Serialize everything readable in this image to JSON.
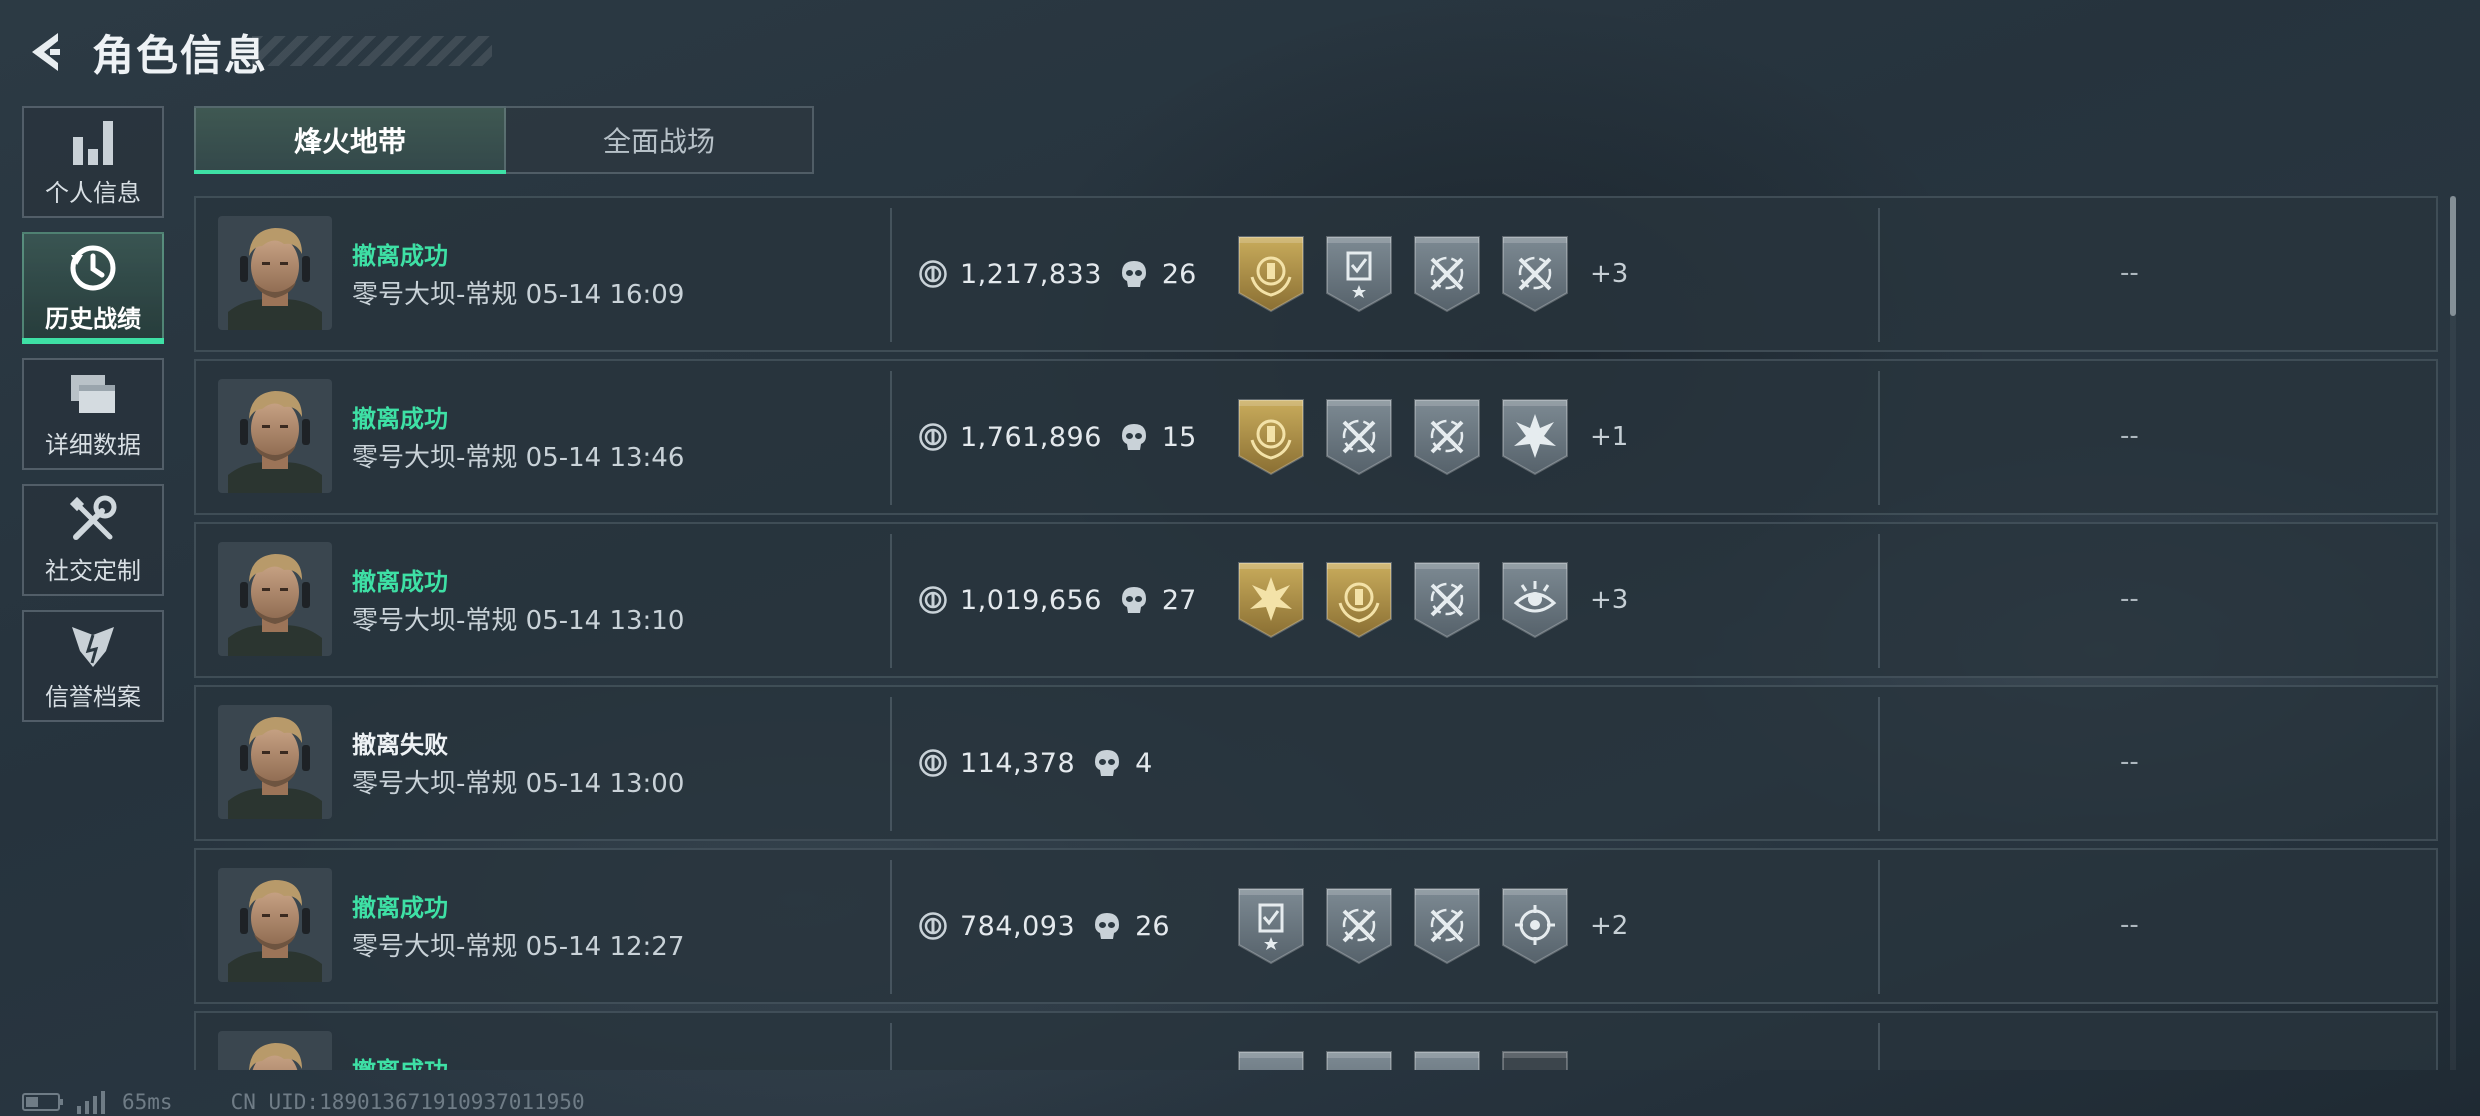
{
  "header": {
    "title": "角色信息"
  },
  "sidebar": {
    "items": [
      {
        "label": "个人信息",
        "icon": "bar-chart-icon",
        "active": false
      },
      {
        "label": "历史战绩",
        "icon": "history-clock-icon",
        "active": true
      },
      {
        "label": "详细数据",
        "icon": "folder-icon",
        "active": false
      },
      {
        "label": "社交定制",
        "icon": "wrench-screwdriver-icon",
        "active": false
      },
      {
        "label": "信誉档案",
        "icon": "reputation-icon",
        "active": false
      }
    ]
  },
  "tabs": [
    {
      "label": "烽火地带",
      "active": true
    },
    {
      "label": "全面战场",
      "active": false
    }
  ],
  "records": [
    {
      "status": "撤离成功",
      "result": "success",
      "map": "零号大坝-常规 05-14 16:09",
      "value": "1,217,833",
      "kills": "26",
      "badges": [
        "gold-medal-badge-icon",
        "clipboard-star-badge-icon",
        "crossed-rifles-badge-icon",
        "crossed-rifles-badge-icon"
      ],
      "more": "+3",
      "extra": "--"
    },
    {
      "status": "撤离成功",
      "result": "success",
      "map": "零号大坝-常规 05-14 13:46",
      "value": "1,761,896",
      "kills": "15",
      "badges": [
        "gold-medal-badge-icon",
        "crossed-rifles-badge-icon",
        "crossed-rifles-badge-icon",
        "explosion-badge-icon"
      ],
      "more": "+1",
      "extra": "--"
    },
    {
      "status": "撤离成功",
      "result": "success",
      "map": "零号大坝-常规 05-14 13:10",
      "value": "1,019,656",
      "kills": "27",
      "badges": [
        "gold-burst-badge-icon",
        "gold-medal-badge-icon",
        "crossed-rifles-badge-icon",
        "eye-badge-icon"
      ],
      "more": "+3",
      "extra": "--"
    },
    {
      "status": "撤离失败",
      "result": "fail",
      "map": "零号大坝-常规 05-14 13:00",
      "value": "114,378",
      "kills": "4",
      "badges": [],
      "more": "",
      "extra": "--"
    },
    {
      "status": "撤离成功",
      "result": "success",
      "map": "零号大坝-常规 05-14 12:27",
      "value": "784,093",
      "kills": "26",
      "badges": [
        "clipboard-star-badge-icon",
        "crossed-rifles-badge-icon",
        "crossed-rifles-badge-icon",
        "target-badge-icon"
      ],
      "more": "+2",
      "extra": "--"
    },
    {
      "status": "撤离成功",
      "result": "success",
      "map": "",
      "value": "",
      "kills": "",
      "badges": [
        "star-badge-icon",
        "star-badge-icon",
        "crossed-rifles-badge-icon",
        "dark-badge-icon"
      ],
      "more": "",
      "extra": ""
    }
  ],
  "statusbar": {
    "ping": "65ms",
    "uid": "CN UID:189013671910937011950"
  },
  "colors": {
    "accent": "#3ee0a5",
    "gold": "#b89a4e",
    "panel": "#28343d"
  }
}
